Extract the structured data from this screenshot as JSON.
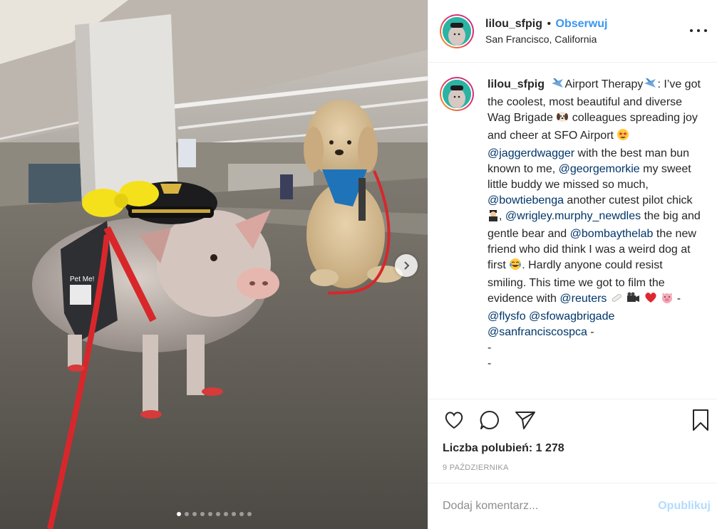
{
  "colors": {
    "accent": "#3897f0",
    "mention": "#003569",
    "post_button_disabled": "#b3dbff",
    "border": "#efefef"
  },
  "photo": {
    "alt_subject": "pig-in-pilot-hat-and-dog-at-airport",
    "carousel_count": 10,
    "carousel_active": 1,
    "next_icon": "chevron-right-icon"
  },
  "header": {
    "username": "lilou_sfpig",
    "separator": "•",
    "follow_label": "Obserwuj",
    "location": "San Francisco, California",
    "more_icon": "ellipsis-icon"
  },
  "caption": {
    "username": "lilou_sfpig",
    "seg1": "Airport Therapy",
    "seg2": ": I’ve got the coolest, most beautiful and diverse Wag Brigade ",
    "seg3": " colleagues spreading joy and cheer at SFO Airport ",
    "mention1": "@jaggerdwagger",
    "seg4": " with the best man bun known to me, ",
    "mention2": "@georgemorkie",
    "seg5": " my sweet little buddy we missed so much, ",
    "mention3": "@bowtiebenga",
    "seg6": " another cutest pilot chick",
    "seg7": ", ",
    "mention4": "@wrigley.murphy_newdles",
    "seg8": " the big and gentle bear and ",
    "mention5": "@bombaythelab",
    "seg9": " the new friend who did think I was a weird dog at first ",
    "seg10": ". Hardly anyone could resist smiling. This time we got to film the evidence with ",
    "mention6": "@reuters",
    "seg11": " -",
    "mention7": "@flysfo",
    "mention8": "@sfowagbrigade",
    "mention9": "@sanfranciscospca",
    "seg12": " -",
    "dash1": "-",
    "dash2": "-",
    "emoji_icons": [
      "airplane-icon",
      "dog-face-icon",
      "star-struck-icon",
      "pilot-icon",
      "tears-of-joy-icon",
      "bandage-icon",
      "camera-icon",
      "heart-icon",
      "pig-face-icon"
    ]
  },
  "actions": {
    "like_icon": "heart-outline-icon",
    "comment_icon": "speech-bubble-icon",
    "share_icon": "paper-plane-icon",
    "save_icon": "bookmark-icon",
    "likes_text": "Liczba polubień: 1 278",
    "date": "9 PAŹDZIERNIKA"
  },
  "comment": {
    "placeholder": "Dodaj komentarz...",
    "post_label": "Opublikuj"
  }
}
